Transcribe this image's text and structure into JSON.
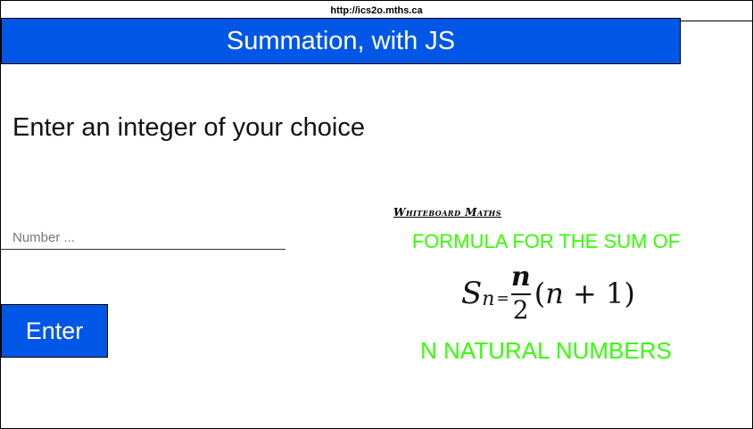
{
  "browser": {
    "url": "http://ics2o.mths.ca"
  },
  "header": {
    "title": "Summation, with JS"
  },
  "main": {
    "prompt": "Enter an integer of your choice",
    "number_input": {
      "placeholder": "Number ...",
      "value": ""
    },
    "enter_button": "Enter"
  },
  "formula_image": {
    "brand": "Whiteboard Maths",
    "top_text": "FORMULA FOR THE SUM OF",
    "formula": {
      "lhs": "S",
      "subscript": "n",
      "equals": "=",
      "numerator": "n",
      "denominator": "2",
      "rest_open": "(",
      "rest_var": "n",
      "rest_tail": " + 1)"
    },
    "bottom_text": "N NATURAL NUMBERS",
    "accent_color": "#33ff00"
  },
  "colors": {
    "primary": "#0057e7",
    "text": "#111111"
  }
}
